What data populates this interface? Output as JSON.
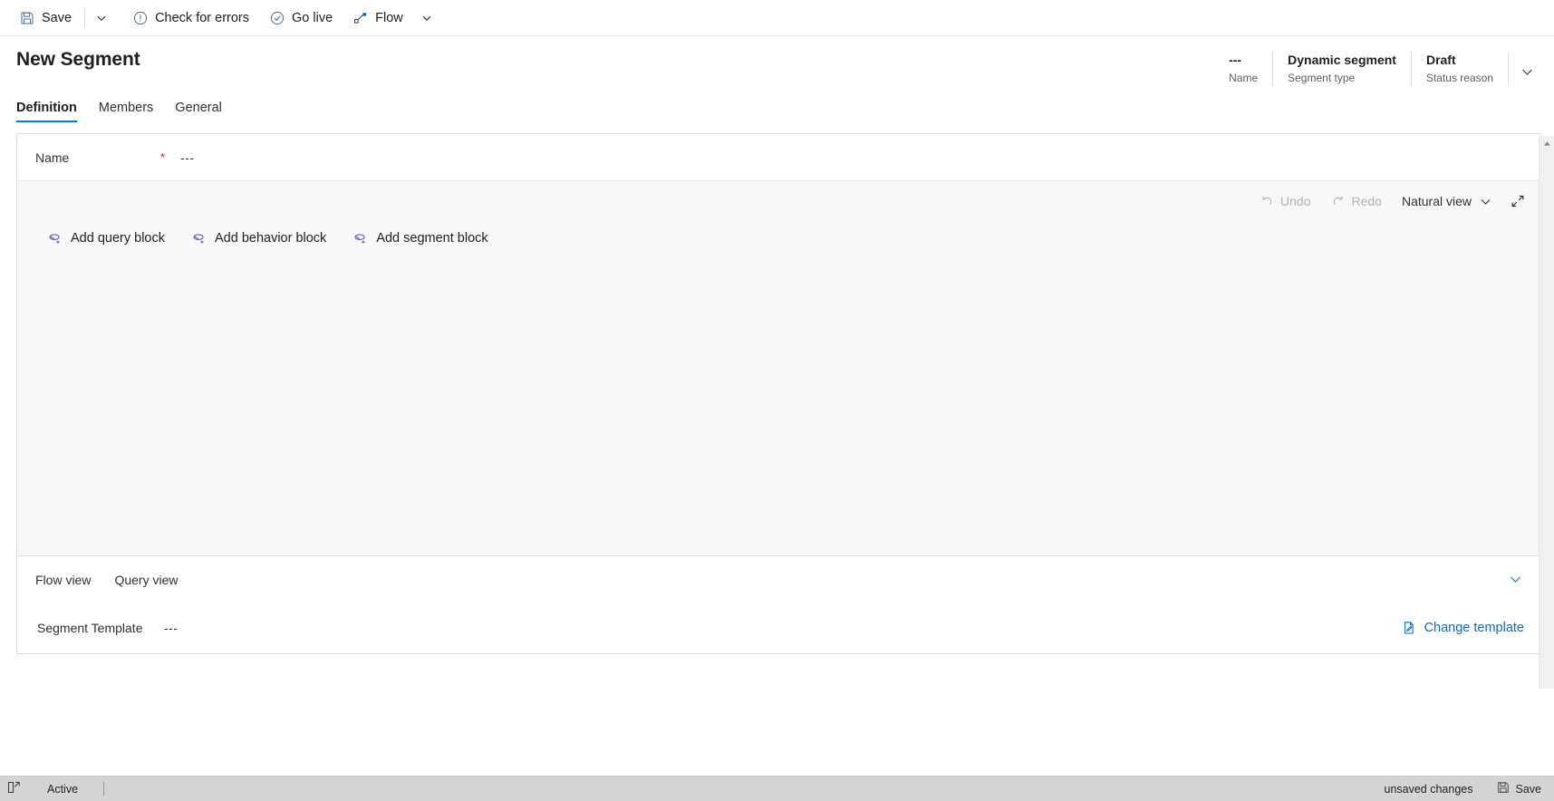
{
  "command_bar": {
    "items": [
      {
        "label": "Save",
        "icon": "save-icon"
      },
      {
        "label": "Check for errors",
        "icon": "error-circle-icon"
      },
      {
        "label": "Go live",
        "icon": "check-circle-icon"
      },
      {
        "label": "Flow",
        "icon": "flow-icon"
      }
    ],
    "save_caret": "chevron-down-icon",
    "flow_caret": "chevron-down-icon"
  },
  "header": {
    "title": "New Segment",
    "meta": [
      {
        "value": "---",
        "label": "Name"
      },
      {
        "value": "Dynamic segment",
        "label": "Segment type"
      },
      {
        "value": "Draft",
        "label": "Status reason"
      }
    ],
    "expand_icon": "chevron-down-icon"
  },
  "tabs": [
    {
      "label": "Definition",
      "active": true
    },
    {
      "label": "Members",
      "active": false
    },
    {
      "label": "General",
      "active": false
    }
  ],
  "form": {
    "name_label": "Name",
    "required_marker": "*",
    "name_value": "---"
  },
  "canvas": {
    "toolbar": [
      {
        "label": "Undo",
        "icon": "undo-icon",
        "disabled": true
      },
      {
        "label": "Redo",
        "icon": "redo-icon",
        "disabled": true
      },
      {
        "label": "Natural view",
        "icon": "chevron-down-icon",
        "disabled": false
      }
    ],
    "expand_label": "expand-icon",
    "blocks": [
      {
        "label": "Add query block",
        "icon": "add-query-block-icon"
      },
      {
        "label": "Add behavior block",
        "icon": "add-behavior-block-icon"
      },
      {
        "label": "Add segment block",
        "icon": "add-segment-block-icon"
      }
    ]
  },
  "view_strip": {
    "links": [
      {
        "label": "Flow view"
      },
      {
        "label": "Query view"
      }
    ],
    "collapse_icon": "chevron-down-icon"
  },
  "template": {
    "label": "Segment Template",
    "value": "---",
    "change_label": "Change template",
    "change_icon": "edit-document-icon"
  },
  "status_bar": {
    "icon": "popout-icon",
    "state": "Active",
    "unsaved": "unsaved changes",
    "save_label": "Save",
    "save_icon": "save-icon"
  },
  "colors": {
    "accent": "#0078d4",
    "link": "#0f6cbd",
    "required": "#a4262c",
    "block_icon": "#5b5fc7",
    "canvas_bg": "#f8f8f8",
    "status_bg": "#d4d4d4"
  }
}
